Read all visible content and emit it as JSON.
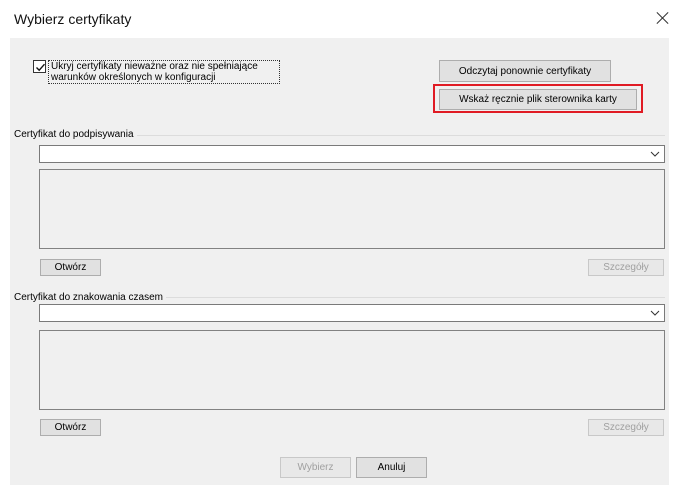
{
  "window": {
    "title": "Wybierz certyfikaty",
    "close_icon": "close-icon"
  },
  "options": {
    "hide_invalid_checked": true,
    "hide_invalid_label": "Ukryj certyfikaty nieważne oraz nie spełniające warunków określonych w konfiguracji"
  },
  "buttons": {
    "reload_certificates": "Odczytaj ponownie certyfikaty",
    "select_driver_manually": "Wskaż ręcznie plik sterownika karty"
  },
  "signing": {
    "group_label": "Certyfikat do podpisywania",
    "selected_value": "",
    "open_label": "Otwórz",
    "details_label": "Szczegóły"
  },
  "timestamping": {
    "group_label": "Certyfikat do znakowania czasem",
    "selected_value": "",
    "open_label": "Otwórz",
    "details_label": "Szczegóły"
  },
  "footer": {
    "select_label": "Wybierz",
    "cancel_label": "Anuluj"
  },
  "colors": {
    "highlight": "#e01b24",
    "dialog_background": "#f0f0f0"
  }
}
